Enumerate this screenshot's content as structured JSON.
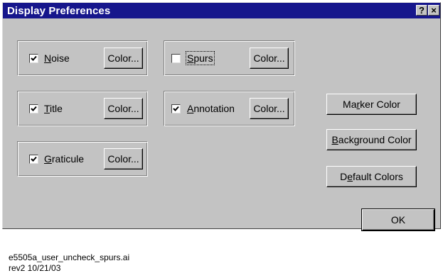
{
  "window": {
    "title": "Display Preferences",
    "help_label": "?",
    "close_label": "×"
  },
  "groups": {
    "noise": {
      "label": "Noise",
      "mnemonic": "N",
      "checked": true,
      "color_button": "Color..."
    },
    "title": {
      "label": "Title",
      "mnemonic": "T",
      "checked": true,
      "color_button": "Color..."
    },
    "graticule": {
      "label": "Graticule",
      "mnemonic": "G",
      "checked": true,
      "color_button": "Color..."
    },
    "spurs": {
      "label": "Spurs",
      "mnemonic": "S",
      "checked": false,
      "color_button": "Color..."
    },
    "annotation": {
      "label": "Annotation",
      "mnemonic": "A",
      "checked": true,
      "color_button": "Color..."
    }
  },
  "buttons": {
    "marker_color": "Marker Color",
    "background_color": "Background Color",
    "default_colors": "Default Colors",
    "ok": "OK"
  },
  "caption": {
    "line1": "e5505a_user_uncheck_spurs.ai",
    "line2": "rev2 10/21/03"
  },
  "colors": {
    "titlebar": "#16168c",
    "face": "#c3c3c3"
  }
}
